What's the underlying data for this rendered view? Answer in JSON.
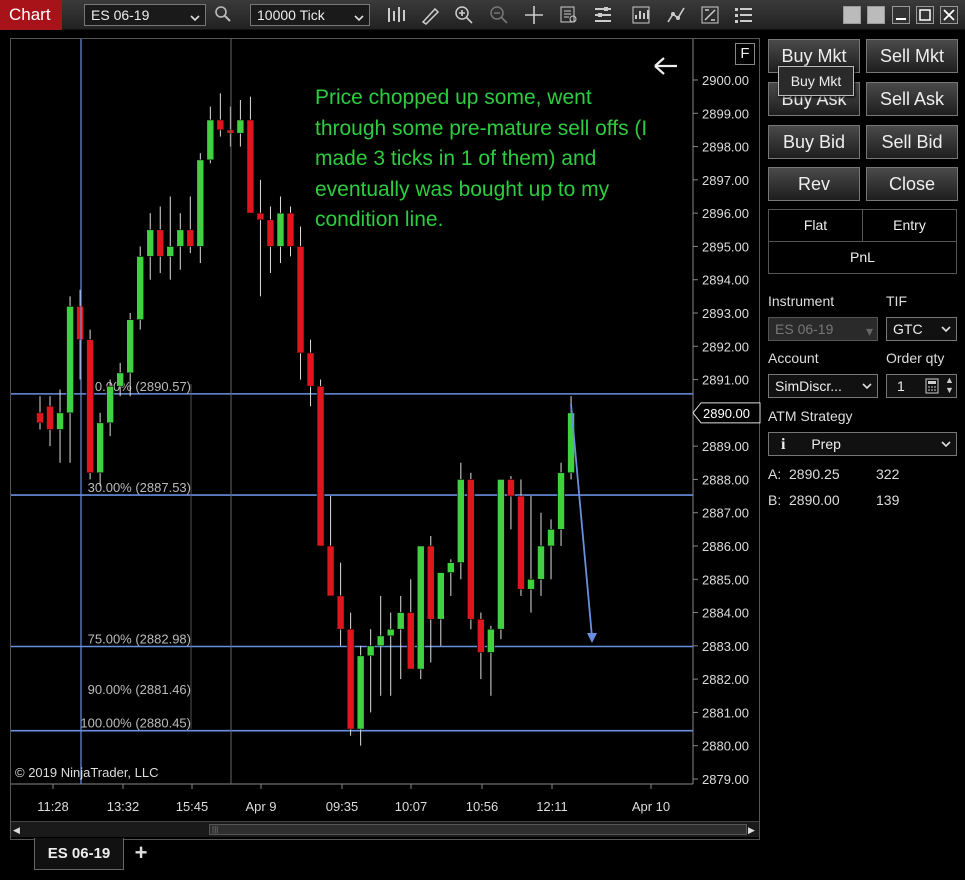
{
  "window": {
    "title": "Chart"
  },
  "toolbar": {
    "instrument": "ES 06-19",
    "interval": "10000 Tick",
    "icons": [
      "magnify-icon",
      "bar-type-icon",
      "draw-pencil-icon",
      "zoom-in-icon",
      "zoom-out-icon",
      "crosshair-icon",
      "data-box-icon",
      "properties-icon",
      "strategies-icon",
      "indicators-icon",
      "chart-trader-icon",
      "list-icon"
    ]
  },
  "chart": {
    "corner_label": "F",
    "copyright": "© 2019 NinjaTrader, LLC",
    "annotation_lines": [
      "Price chopped up some, went",
      "through some pre-mature sell offs (I",
      "made 3 ticks in 1 of them) and",
      "eventually was bought up to my",
      "condition line."
    ],
    "current_price": "2890.00",
    "scrollbar": "|||"
  },
  "chart_data": {
    "type": "candlestick",
    "title": "",
    "ylim": [
      2878.7,
      2901.5
    ],
    "y_ticks": [
      "2900.00",
      "2899.00",
      "2898.00",
      "2897.00",
      "2896.00",
      "2895.00",
      "2894.00",
      "2893.00",
      "2892.00",
      "2891.00",
      "2890.00",
      "2889.00",
      "2888.00",
      "2887.00",
      "2886.00",
      "2885.00",
      "2884.00",
      "2883.00",
      "2882.00",
      "2881.00",
      "2880.00",
      "2879.00"
    ],
    "x_ticks": [
      "11:28",
      "13:32",
      "15:45",
      "Apr 9",
      "09:35",
      "10:07",
      "10:56",
      "12:11",
      "Apr 10"
    ],
    "fib_levels": [
      {
        "label": "0.00% (2890.57)",
        "price": 2890.57
      },
      {
        "label": "30.00% (2887.53)",
        "price": 2887.53
      },
      {
        "label": "75.00% (2882.98)",
        "price": 2882.98
      },
      {
        "label": "90.00% (2881.46)",
        "price": 2881.46
      },
      {
        "label": "100.00% (2880.45)",
        "price": 2880.45
      }
    ],
    "candles": [
      [
        2890.0,
        2890.5,
        2889.5,
        2889.7
      ],
      [
        2890.2,
        2890.5,
        2889.0,
        2889.5
      ],
      [
        2889.5,
        2890.7,
        2888.5,
        2890.0
      ],
      [
        2890.0,
        2893.5,
        2888.5,
        2893.2
      ],
      [
        2893.2,
        2893.7,
        2891.0,
        2892.2
      ],
      [
        2892.2,
        2892.5,
        2888.0,
        2888.2
      ],
      [
        2888.2,
        2890.0,
        2887.8,
        2889.7
      ],
      [
        2889.7,
        2891.0,
        2889.3,
        2890.8
      ],
      [
        2890.8,
        2891.5,
        2890.5,
        2891.2
      ],
      [
        2891.2,
        2893.0,
        2890.5,
        2892.8
      ],
      [
        2892.8,
        2895.0,
        2892.5,
        2894.7
      ],
      [
        2894.7,
        2896.0,
        2894.0,
        2895.5
      ],
      [
        2895.5,
        2896.2,
        2894.2,
        2894.7
      ],
      [
        2894.7,
        2896.5,
        2894.0,
        2895.0
      ],
      [
        2895.0,
        2896.0,
        2894.3,
        2895.5
      ],
      [
        2895.5,
        2896.5,
        2894.8,
        2895.0
      ],
      [
        2895.0,
        2897.8,
        2894.5,
        2897.6
      ],
      [
        2897.6,
        2899.2,
        2897.5,
        2898.8
      ],
      [
        2898.8,
        2899.6,
        2898.3,
        2898.5
      ],
      [
        2898.5,
        2899.2,
        2898.0,
        2898.4
      ],
      [
        2898.4,
        2899.4,
        2898.0,
        2898.8
      ],
      [
        2898.8,
        2899.5,
        2896.8,
        2896.0
      ],
      [
        2896.0,
        2897.0,
        2893.5,
        2895.8
      ],
      [
        2895.8,
        2896.2,
        2894.2,
        2895.0
      ],
      [
        2895.0,
        2896.5,
        2894.5,
        2896.0
      ],
      [
        2896.0,
        2896.2,
        2894.7,
        2895.0
      ],
      [
        2895.0,
        2895.6,
        2891.0,
        2891.8
      ],
      [
        2891.8,
        2892.2,
        2890.2,
        2890.8
      ],
      [
        2890.8,
        2891.0,
        2888.0,
        2886.0
      ],
      [
        2886.0,
        2887.5,
        2885.5,
        2884.5
      ],
      [
        2884.5,
        2885.5,
        2883.0,
        2883.5
      ],
      [
        2883.5,
        2884.0,
        2880.3,
        2880.5
      ],
      [
        2880.5,
        2883.0,
        2880.0,
        2882.7
      ],
      [
        2882.7,
        2883.5,
        2881.0,
        2883.0
      ],
      [
        2883.0,
        2884.5,
        2881.5,
        2883.3
      ],
      [
        2883.3,
        2884.0,
        2881.5,
        2883.5
      ],
      [
        2883.5,
        2884.5,
        2882.0,
        2884.0
      ],
      [
        2884.0,
        2885.0,
        2882.5,
        2882.3
      ],
      [
        2882.3,
        2885.5,
        2882.0,
        2886.0
      ],
      [
        2886.0,
        2886.3,
        2882.5,
        2883.8
      ],
      [
        2883.8,
        2885.2,
        2883.0,
        2885.2
      ],
      [
        2885.2,
        2885.6,
        2884.5,
        2885.5
      ],
      [
        2885.5,
        2888.5,
        2885.0,
        2888.0
      ],
      [
        2888.0,
        2888.2,
        2883.5,
        2883.8
      ],
      [
        2883.8,
        2884.0,
        2882.0,
        2882.8
      ],
      [
        2882.8,
        2883.6,
        2881.5,
        2883.5
      ],
      [
        2883.5,
        2888.0,
        2883.2,
        2888.0
      ],
      [
        2888.0,
        2888.1,
        2886.5,
        2887.5
      ],
      [
        2887.5,
        2888.0,
        2884.5,
        2884.7
      ],
      [
        2884.7,
        2887.5,
        2884.0,
        2885.0
      ],
      [
        2885.0,
        2887.0,
        2884.5,
        2886.0
      ],
      [
        2886.0,
        2886.8,
        2885.0,
        2886.5
      ],
      [
        2886.5,
        2888.5,
        2886.0,
        2888.2
      ],
      [
        2888.2,
        2890.5,
        2888.0,
        2890.0
      ]
    ]
  },
  "trader": {
    "buy_mkt": "Buy Mkt",
    "sell_mkt": "Sell Mkt",
    "buy_ask": "Buy Ask",
    "sell_ask": "Sell Ask",
    "buy_bid": "Buy Bid",
    "sell_bid": "Sell Bid",
    "rev": "Rev",
    "close": "Close",
    "flat": "Flat",
    "entry": "Entry",
    "pnl": "PnL",
    "instrument_label": "Instrument",
    "instrument_value": "ES 06-19",
    "tif_label": "TIF",
    "tif_value": "GTC",
    "account_label": "Account",
    "account_value": "SimDiscr...",
    "qty_label": "Order qty",
    "qty_value": "1",
    "atm_label": "ATM Strategy",
    "atm_value": "Prep",
    "ask_label": "A:",
    "ask_price": "2890.25",
    "ask_size": "322",
    "bid_label": "B:",
    "bid_price": "2890.00",
    "bid_size": "139",
    "tooltip": "Buy Mkt"
  },
  "tabs": {
    "active": "ES 06-19",
    "add": "+"
  },
  "colors": {
    "up": "#3fd13f",
    "down": "#e0161e",
    "fib": "#6a8fe0",
    "annotation": "#2ecc40",
    "title_tab": "#a8131a"
  }
}
